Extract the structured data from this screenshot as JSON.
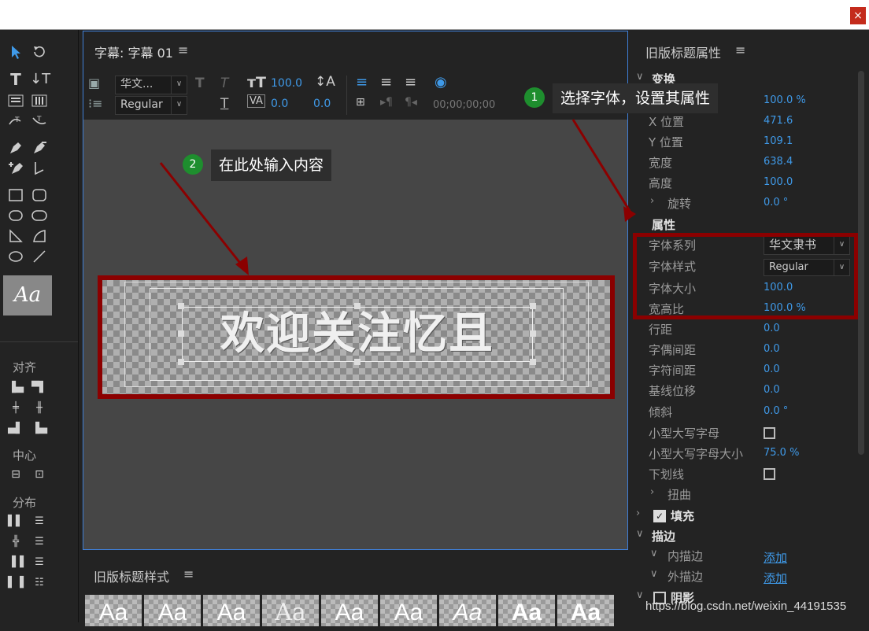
{
  "window": {
    "close_symbol": "×"
  },
  "tools": {
    "align_label": "对齐",
    "center_label": "中心",
    "distribute_label": "分布",
    "style_swatch": "Aa"
  },
  "title_panel": {
    "tab_label": "字幕: 字幕 01",
    "menu_symbol": "≡",
    "font_family": "华文...",
    "font_style": "Regular",
    "font_size": "100.0",
    "kerning": "0.0",
    "tracking": "0.0",
    "timecode": "00;00;00;00",
    "canvas_text": "欢迎关注忆且"
  },
  "styles_panel": {
    "title": "旧版标题样式",
    "menu_symbol": "≡",
    "swatches": [
      "Aa",
      "Aa",
      "Aa",
      "Aa",
      "Aa",
      "Aa",
      "Aa",
      "Aa",
      "Aa"
    ]
  },
  "props_panel": {
    "title": "旧版标题属性",
    "menu_symbol": "≡",
    "transform_label": "变换",
    "rows": [
      {
        "label": "",
        "value": "100.0 %"
      },
      {
        "label": "X 位置",
        "value": "471.6"
      },
      {
        "label": "Y 位置",
        "value": "109.1"
      },
      {
        "label": "宽度",
        "value": "638.4"
      },
      {
        "label": "高度",
        "value": "100.0"
      },
      {
        "label": "旋转",
        "value": "0.0 °"
      }
    ],
    "attributes_label": "属性",
    "font_family_label": "字体系列",
    "font_family_value": "华文隶书",
    "font_style_label": "字体样式",
    "font_style_value": "Regular",
    "font_size_label": "字体大小",
    "font_size_value": "100.0",
    "aspect_label": "宽高比",
    "aspect_value": "100.0 %",
    "rows2": [
      {
        "label": "行距",
        "value": "0.0"
      },
      {
        "label": "字偶间距",
        "value": "0.0"
      },
      {
        "label": "字符间距",
        "value": "0.0"
      },
      {
        "label": "基线位移",
        "value": "0.0"
      },
      {
        "label": "倾斜",
        "value": "0.0 °"
      }
    ],
    "smallcaps_label": "小型大写字母",
    "smallcaps_size_label": "小型大写字母大小",
    "smallcaps_size_value": "75.0 %",
    "underline_label": "下划线",
    "distort_label": "扭曲",
    "fill_label": "填充",
    "stroke_label": "描边",
    "inner_stroke_label": "内描边",
    "outer_stroke_label": "外描边",
    "add_label": "添加",
    "shadow_label": "阴影"
  },
  "annotations": {
    "badge1": "1",
    "callout1": "选择字体，设置其属性",
    "badge2": "2",
    "callout2": "在此处输入内容",
    "watermark": "https://blog.csdn.net/weixin_44191535"
  },
  "colors": {
    "highlight": "#8b0000",
    "accent": "#3f9ae9",
    "badge": "#1e8e2e"
  }
}
